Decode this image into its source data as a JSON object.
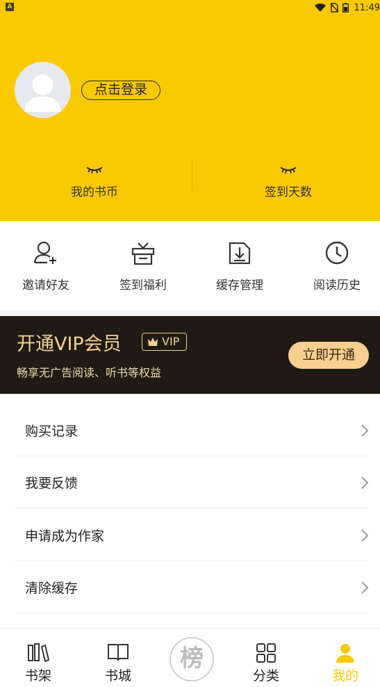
{
  "status_bar": {
    "notification_icon": "A",
    "time": "11:49"
  },
  "profile": {
    "login_label": "点击登录"
  },
  "stats": [
    {
      "label": "我的书币",
      "icon": "closed-eye-icon"
    },
    {
      "label": "签到天数",
      "icon": "closed-eye-icon"
    }
  ],
  "quick_actions": [
    {
      "label": "邀请好友",
      "icon": "add-user-icon"
    },
    {
      "label": "签到福利",
      "icon": "gift-box-icon"
    },
    {
      "label": "缓存管理",
      "icon": "download-icon"
    },
    {
      "label": "阅读历史",
      "icon": "clock-icon"
    }
  ],
  "vip": {
    "title": "开通VIP会员",
    "badge": "VIP",
    "subtitle": "畅享无广告阅读、听书等权益",
    "button": "立即开通"
  },
  "menu": [
    {
      "label": "购买记录"
    },
    {
      "label": "我要反馈"
    },
    {
      "label": "申请成为作家"
    },
    {
      "label": "清除缓存"
    }
  ],
  "tabs": [
    {
      "label": "书架",
      "icon": "bookshelf-icon"
    },
    {
      "label": "书城",
      "icon": "open-book-icon"
    },
    {
      "label": "榜",
      "icon": "ranking-icon"
    },
    {
      "label": "分类",
      "icon": "grid-icon"
    },
    {
      "label": "我的",
      "icon": "person-icon"
    }
  ],
  "colors": {
    "accent": "#fbc902",
    "vip_bg": "#1f1b14",
    "vip_gold": "#f7cf8f"
  }
}
